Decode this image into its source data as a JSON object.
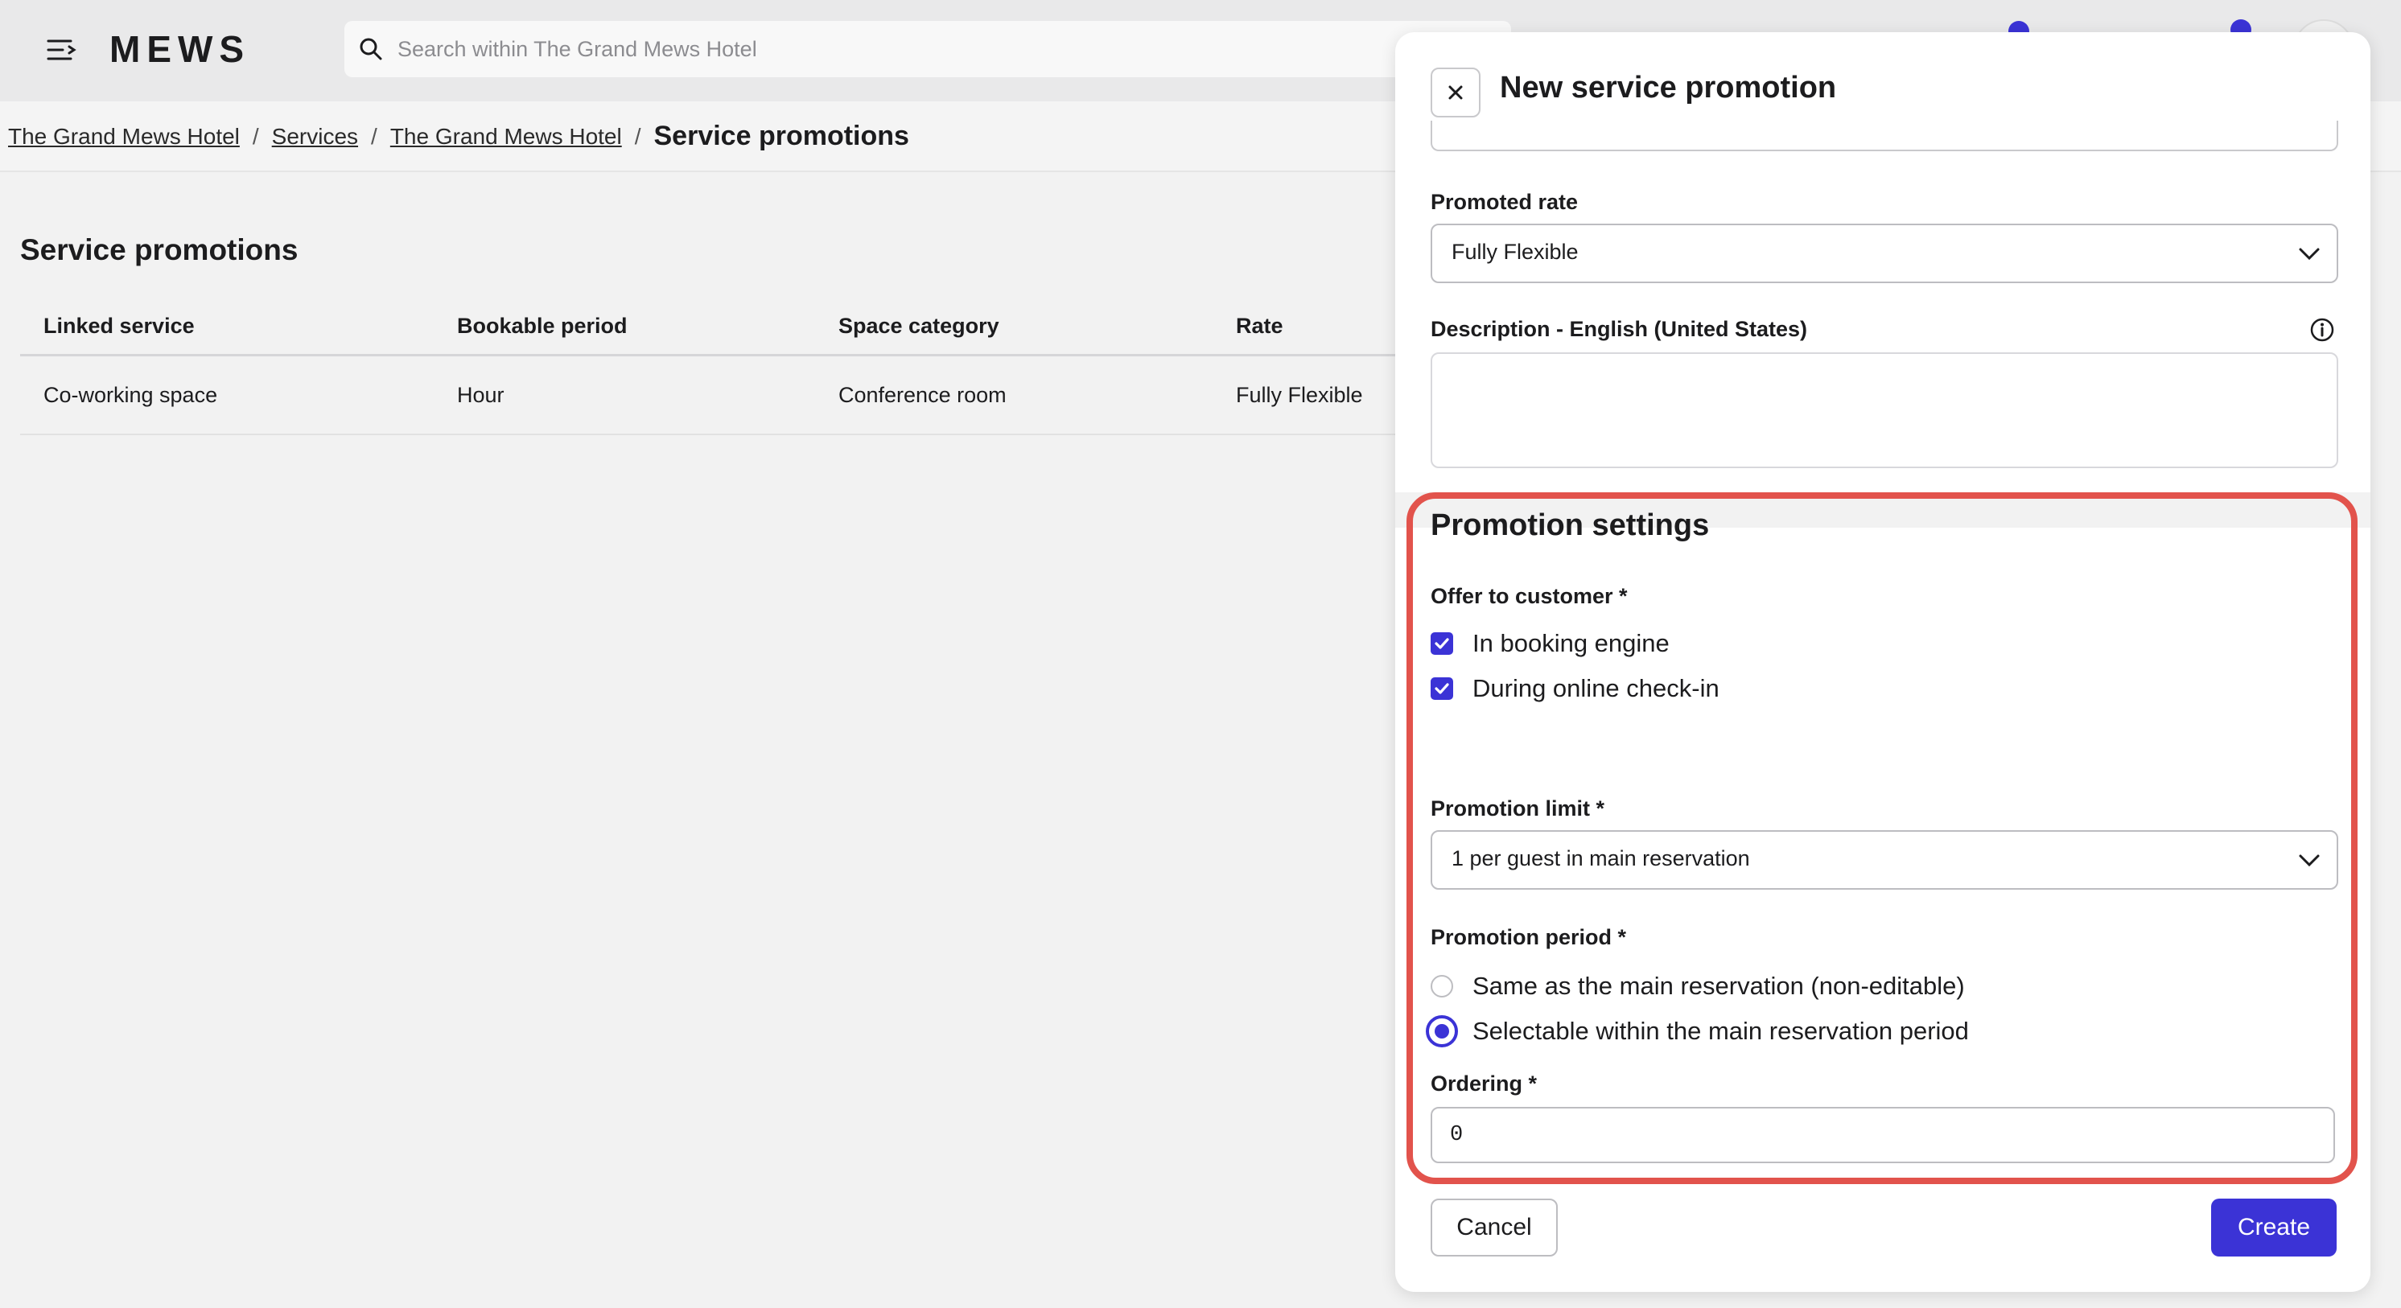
{
  "app": {
    "logo": "MEWS"
  },
  "search": {
    "placeholder": "Search within The Grand Mews Hotel"
  },
  "breadcrumb": {
    "items": [
      "The Grand Mews Hotel",
      "Services",
      "The Grand Mews Hotel"
    ],
    "current": "Service promotions"
  },
  "main": {
    "title": "Service promotions",
    "columns": [
      "Linked service",
      "Bookable period",
      "Space category",
      "Rate"
    ],
    "rows": [
      [
        "Co-working space",
        "Hour",
        "Conference room",
        "Fully Flexible"
      ]
    ]
  },
  "modal": {
    "title": "New service promotion",
    "promoted_rate_label": "Promoted rate",
    "promoted_rate_value": "Fully Flexible",
    "description_label": "Description - English (United States)",
    "settings_title": "Promotion settings",
    "offer_label": "Offer to customer *",
    "offer_options": [
      "In booking engine",
      "During online check-in"
    ],
    "limit_label": "Promotion limit *",
    "limit_value": "1 per guest in main reservation",
    "period_label": "Promotion period *",
    "period_options": [
      "Same as the main reservation (non-editable)",
      "Selectable within the main reservation period"
    ],
    "ordering_label": "Ordering *",
    "ordering_value": "0",
    "cancel_label": "Cancel",
    "create_label": "Create"
  },
  "colors": {
    "accent": "#3b33d6",
    "highlight": "#e2534c"
  }
}
